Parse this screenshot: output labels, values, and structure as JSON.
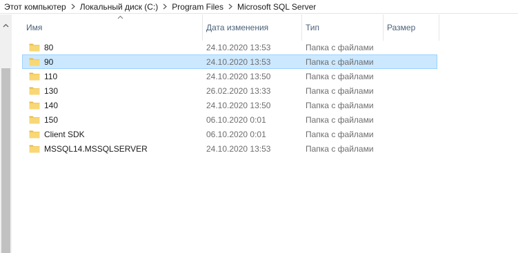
{
  "breadcrumb": [
    "Этот компьютер",
    "Локальный диск (C:)",
    "Program Files",
    "Microsoft SQL Server"
  ],
  "columns": {
    "name": "Имя",
    "date": "Дата изменения",
    "type": "Тип",
    "size": "Размер"
  },
  "files": [
    {
      "name": "80",
      "date": "24.10.2020 13:53",
      "type": "Папка с файлами"
    },
    {
      "name": "90",
      "date": "24.10.2020 13:53",
      "type": "Папка с файлами"
    },
    {
      "name": "110",
      "date": "24.10.2020 13:50",
      "type": "Папка с файлами"
    },
    {
      "name": "130",
      "date": "26.02.2020 13:33",
      "type": "Папка с файлами"
    },
    {
      "name": "140",
      "date": "24.10.2020 13:50",
      "type": "Папка с файлами"
    },
    {
      "name": "150",
      "date": "06.10.2020 0:01",
      "type": "Папка с файлами"
    },
    {
      "name": "Client SDK",
      "date": "06.10.2020 0:01",
      "type": "Папка с файлами"
    },
    {
      "name": "MSSQL14.MSSQLSERVER",
      "date": "24.10.2020 13:53",
      "type": "Папка с файлами"
    }
  ],
  "selected_index": 1,
  "icons": {
    "folder": "folder-icon",
    "sort": "sort-up-icon",
    "scroll_up": "scroll-up-arrow-icon",
    "crumb_sep": "chevron-right-icon"
  },
  "colors": {
    "selection_bg": "#cce8ff",
    "selection_border": "#99d1ff",
    "folder": "#f8d775",
    "header_text": "#4c607a"
  }
}
